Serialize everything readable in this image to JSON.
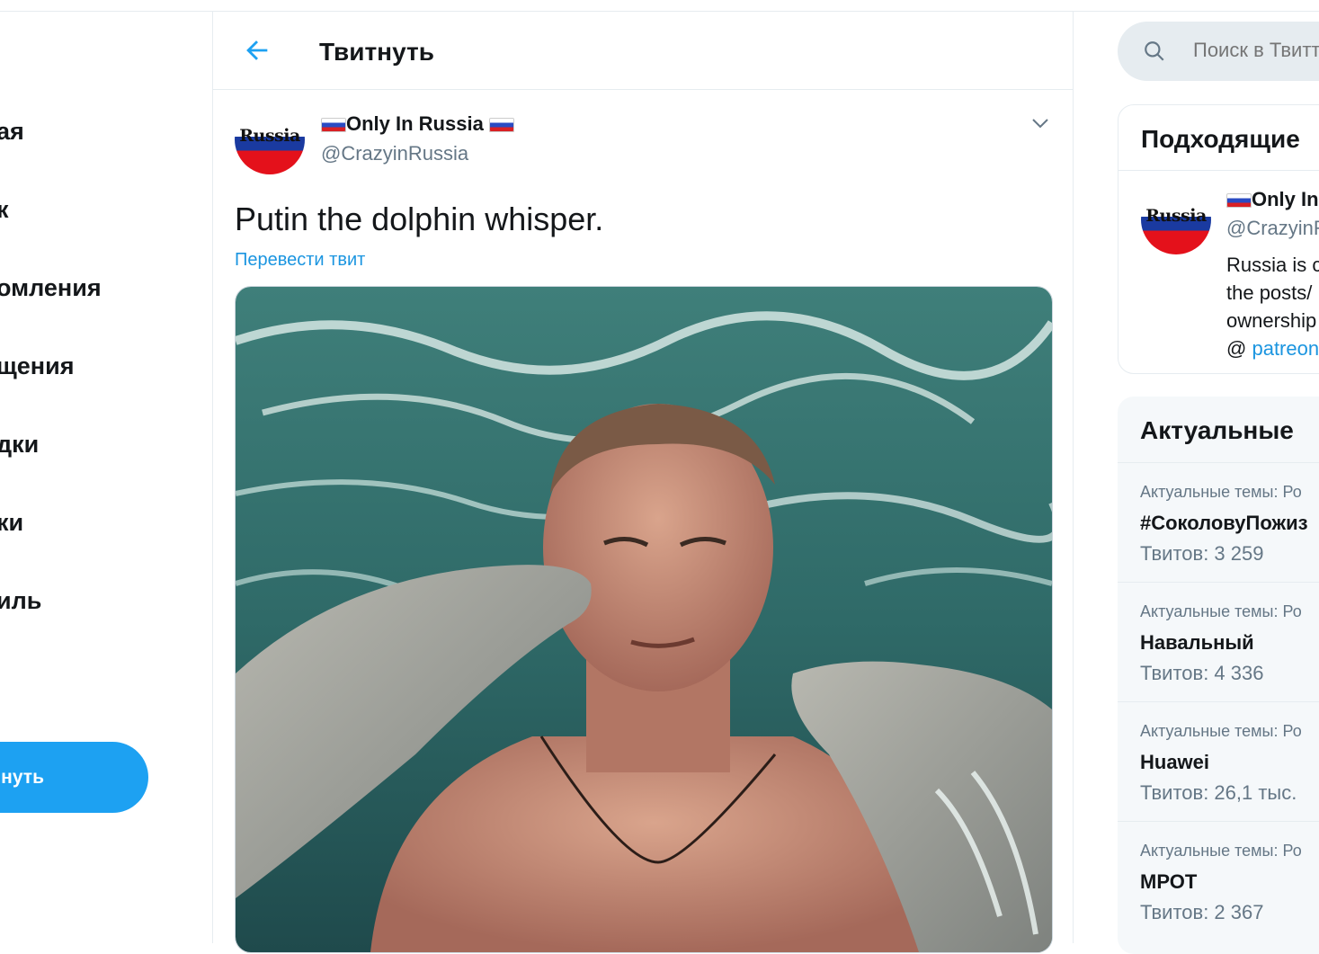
{
  "nav": {
    "items": [
      {
        "label": "ая"
      },
      {
        "label": "к"
      },
      {
        "label": "омления"
      },
      {
        "label": "щения"
      },
      {
        "label": "дки"
      },
      {
        "label": "ки"
      },
      {
        "label": "иль"
      }
    ],
    "tweet_button": "нуть"
  },
  "header": {
    "title": "Твитнуть"
  },
  "tweet": {
    "author_name": "Only In Russia",
    "author_handle": "@CrazyinRussia",
    "avatar_text": "Russia",
    "text": "Putin the dolphin whisper.",
    "translate_link": "Перевести твит"
  },
  "search": {
    "placeholder": "Поиск в Твиттере"
  },
  "suggested": {
    "title": "Подходящие",
    "user": {
      "name": "Only In",
      "handle": "@CrazyinR",
      "avatar_text": "Russia",
      "bio_lines": [
        "Russia is c",
        "the posts/",
        "ownership"
      ],
      "bio_at": "@",
      "bio_link": "patreon"
    }
  },
  "trends": {
    "title": "Актуальные",
    "items": [
      {
        "category": "Актуальные темы: Ро",
        "name": "#СоколовуПожиз",
        "count": "Твитов: 3 259"
      },
      {
        "category": "Актуальные темы: Ро",
        "name": "Навальный",
        "count": "Твитов: 4 336"
      },
      {
        "category": "Актуальные темы: Ро",
        "name": "Huawei",
        "count": "Твитов: 26,1 тыс."
      },
      {
        "category": "Актуальные темы: Ро",
        "name": "МРОТ",
        "count": "Твитов: 2 367"
      }
    ]
  },
  "colors": {
    "accent": "#1da1f2",
    "link": "#1b95e0",
    "muted": "#657786"
  },
  "icons": [
    "back-arrow-icon",
    "chevron-down-icon",
    "search-icon",
    "flag-icon"
  ]
}
